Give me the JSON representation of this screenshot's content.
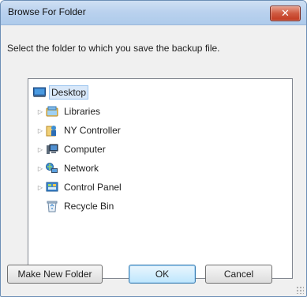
{
  "window": {
    "title": "Browse For Folder",
    "close_glyph": "✕"
  },
  "instruction": "Select the folder to which you save the backup file.",
  "tree": {
    "items": [
      {
        "label": "Desktop",
        "icon": "desktop-icon",
        "expandable": false,
        "selected": true
      },
      {
        "label": "Libraries",
        "icon": "libraries-icon",
        "expandable": true
      },
      {
        "label": "NY Controller",
        "icon": "user-folder-icon",
        "expandable": true
      },
      {
        "label": "Computer",
        "icon": "computer-icon",
        "expandable": true
      },
      {
        "label": "Network",
        "icon": "network-icon",
        "expandable": true
      },
      {
        "label": "Control Panel",
        "icon": "control-panel-icon",
        "expandable": true
      },
      {
        "label": "Recycle Bin",
        "icon": "recycle-bin-icon",
        "expandable": false
      }
    ],
    "expander_glyph": "▷"
  },
  "buttons": {
    "new_folder": "Make New Folder",
    "ok": "OK",
    "cancel": "Cancel"
  },
  "colors": {
    "selection": "#d9e8f9",
    "titlebar": "#b9d1ee",
    "close": "#c2381f"
  }
}
